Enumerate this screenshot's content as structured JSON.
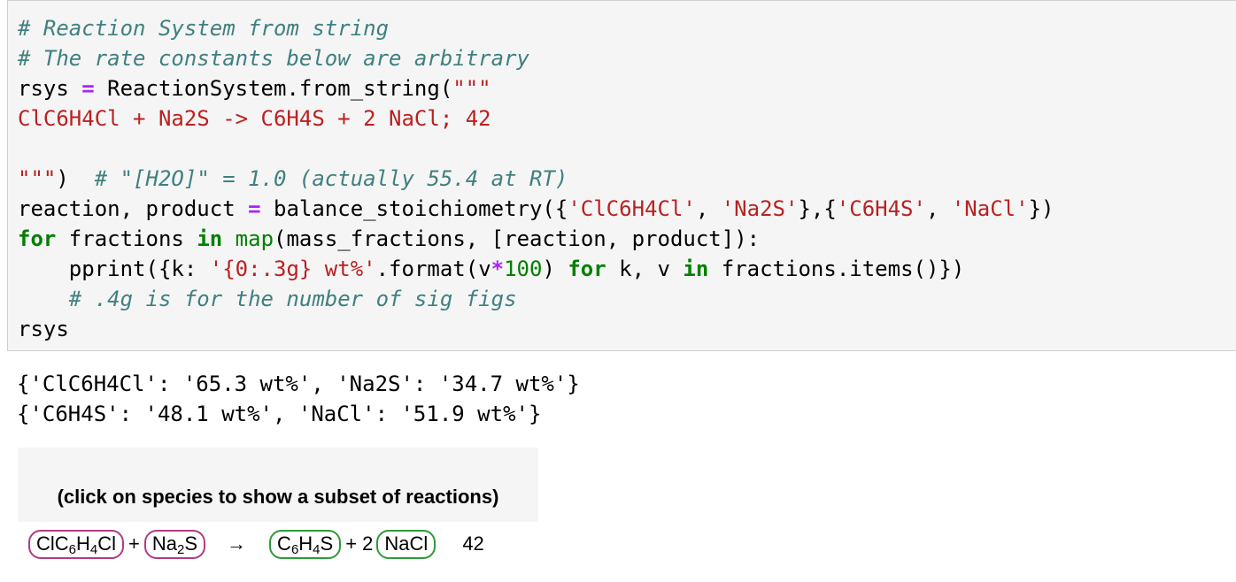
{
  "code_cell": {
    "lines": [
      [
        {
          "c": "cm",
          "t": "# Reaction System from string"
        }
      ],
      [
        {
          "c": "cm",
          "t": "# The rate constants below are arbitrary"
        }
      ],
      [
        {
          "c": "",
          "t": "rsys "
        },
        {
          "c": "op",
          "t": "="
        },
        {
          "c": "",
          "t": " ReactionSystem.from_string("
        },
        {
          "c": "st",
          "t": "\"\"\""
        }
      ],
      [
        {
          "c": "st",
          "t": "ClC6H4Cl + Na2S -> C6H4S + 2 NaCl; 42"
        }
      ],
      [
        {
          "c": "",
          "t": " "
        }
      ],
      [
        {
          "c": "st",
          "t": "\"\"\""
        },
        {
          "c": "",
          "t": ")  "
        },
        {
          "c": "cm",
          "t": "# \"[H2O]\" = 1.0 (actually 55.4 at RT)"
        }
      ],
      [
        {
          "c": "",
          "t": "reaction, product "
        },
        {
          "c": "op",
          "t": "="
        },
        {
          "c": "",
          "t": " balance_stoichiometry({"
        },
        {
          "c": "st",
          "t": "'ClC6H4Cl'"
        },
        {
          "c": "",
          "t": ", "
        },
        {
          "c": "st",
          "t": "'Na2S'"
        },
        {
          "c": "",
          "t": "},{"
        },
        {
          "c": "st",
          "t": "'C6H4S'"
        },
        {
          "c": "",
          "t": ", "
        },
        {
          "c": "st",
          "t": "'NaCl'"
        },
        {
          "c": "",
          "t": "})"
        }
      ],
      [
        {
          "c": "kw",
          "t": "for"
        },
        {
          "c": "",
          "t": " fractions "
        },
        {
          "c": "kw",
          "t": "in"
        },
        {
          "c": "",
          "t": " "
        },
        {
          "c": "bi",
          "t": "map"
        },
        {
          "c": "",
          "t": "(mass_fractions, [reaction, product]):"
        }
      ],
      [
        {
          "c": "",
          "t": "    pprint({k: "
        },
        {
          "c": "st",
          "t": "'{0:.3g} wt%'"
        },
        {
          "c": "",
          "t": ".format(v"
        },
        {
          "c": "op",
          "t": "*"
        },
        {
          "c": "nu",
          "t": "100"
        },
        {
          "c": "",
          "t": ") "
        },
        {
          "c": "kw",
          "t": "for"
        },
        {
          "c": "",
          "t": " k, v "
        },
        {
          "c": "kw",
          "t": "in"
        },
        {
          "c": "",
          "t": " fractions.items()})"
        }
      ],
      [
        {
          "c": "",
          "t": "    "
        },
        {
          "c": "cm",
          "t": "# .4g is for the number of sig figs"
        }
      ],
      [
        {
          "c": "",
          "t": "rsys"
        }
      ]
    ]
  },
  "output": {
    "lines": [
      "{'ClC6H4Cl': '65.3 wt%', 'Na2S': '34.7 wt%'}",
      "{'C6H4S': '48.1 wt%', 'NaCl': '51.9 wt%'}"
    ]
  },
  "rsys_display": {
    "header": "(click on species to show a subset of reactions)",
    "reaction": {
      "reactants": [
        {
          "base": [
            "ClC",
            "H",
            "Cl"
          ],
          "subs": [
            "6",
            "4"
          ]
        },
        {
          "base": [
            "Na",
            "S"
          ],
          "subs": [
            "2"
          ]
        }
      ],
      "plus": "+",
      "arrow": "→",
      "products_coef": "+ 2",
      "products": [
        {
          "base": [
            "C",
            "H",
            "S"
          ],
          "subs": [
            "6",
            "4"
          ]
        },
        {
          "base": [
            "NaCl"
          ],
          "subs": []
        }
      ],
      "rate": "42"
    },
    "colors": {
      "reactant_border": "#b03c82",
      "product_border": "#2e9a3a"
    }
  }
}
